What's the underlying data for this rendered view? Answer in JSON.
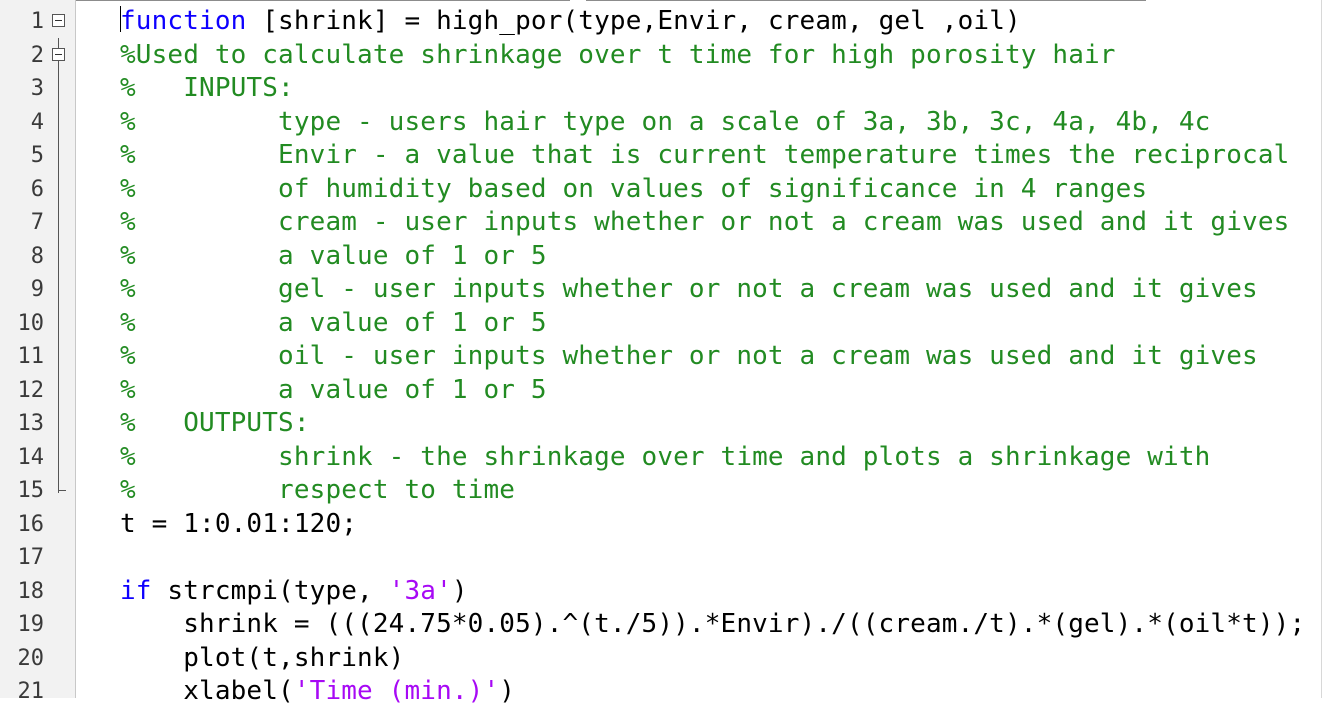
{
  "editor": {
    "lines": [
      {
        "n": "1",
        "fold": "open",
        "parts": [
          {
            "c": "kw",
            "t": "function"
          },
          {
            "c": "tx",
            "t": " [shrink] = high_por(type,Envir, cream, gel ,oil)"
          }
        ]
      },
      {
        "n": "2",
        "fold": "open",
        "parts": [
          {
            "c": "cm",
            "t": "%Used to calculate shrinkage over t time for high porosity hair"
          }
        ]
      },
      {
        "n": "3",
        "parts": [
          {
            "c": "cm",
            "t": "%   INPUTS:"
          }
        ]
      },
      {
        "n": "4",
        "parts": [
          {
            "c": "cm",
            "t": "%         type - users hair type on a scale of 3a, 3b, 3c, 4a, 4b, 4c"
          }
        ]
      },
      {
        "n": "5",
        "parts": [
          {
            "c": "cm",
            "t": "%         Envir - a value that is current temperature times the reciprocal"
          }
        ]
      },
      {
        "n": "6",
        "parts": [
          {
            "c": "cm",
            "t": "%         of humidity based on values of significance in 4 ranges"
          }
        ]
      },
      {
        "n": "7",
        "parts": [
          {
            "c": "cm",
            "t": "%         cream - user inputs whether or not a cream was used and it gives"
          }
        ]
      },
      {
        "n": "8",
        "parts": [
          {
            "c": "cm",
            "t": "%         a value of 1 or 5"
          }
        ]
      },
      {
        "n": "9",
        "parts": [
          {
            "c": "cm",
            "t": "%         gel - user inputs whether or not a cream was used and it gives"
          }
        ]
      },
      {
        "n": "10",
        "parts": [
          {
            "c": "cm",
            "t": "%         a value of 1 or 5"
          }
        ]
      },
      {
        "n": "11",
        "parts": [
          {
            "c": "cm",
            "t": "%         oil - user inputs whether or not a cream was used and it gives"
          }
        ]
      },
      {
        "n": "12",
        "parts": [
          {
            "c": "cm",
            "t": "%         a value of 1 or 5"
          }
        ]
      },
      {
        "n": "13",
        "parts": [
          {
            "c": "cm",
            "t": "%   OUTPUTS:"
          }
        ]
      },
      {
        "n": "14",
        "parts": [
          {
            "c": "cm",
            "t": "%         shrink - the shrinkage over time and plots a shrinkage with"
          }
        ]
      },
      {
        "n": "15",
        "fold": "end",
        "parts": [
          {
            "c": "cm",
            "t": "%         respect to time"
          }
        ]
      },
      {
        "n": "16",
        "parts": [
          {
            "c": "tx",
            "t": "t = 1:0.01:120;"
          }
        ]
      },
      {
        "n": "17",
        "parts": [
          {
            "c": "tx",
            "t": ""
          }
        ]
      },
      {
        "n": "18",
        "parts": [
          {
            "c": "kw",
            "t": "if"
          },
          {
            "c": "tx",
            "t": " strcmpi(type, "
          },
          {
            "c": "st",
            "t": "'3a'"
          },
          {
            "c": "tx",
            "t": ")"
          }
        ]
      },
      {
        "n": "19",
        "parts": [
          {
            "c": "tx",
            "t": "    shrink = (((24.75*0.05).^(t./5)).*Envir)./((cream./t).*(gel).*(oil*t));"
          }
        ]
      },
      {
        "n": "20",
        "parts": [
          {
            "c": "tx",
            "t": "    plot(t,shrink)"
          }
        ]
      },
      {
        "n": "21",
        "parts": [
          {
            "c": "tx",
            "t": "    xlabel("
          },
          {
            "c": "st",
            "t": "'Time (min.)'"
          },
          {
            "c": "tx",
            "t": ")"
          }
        ]
      }
    ]
  }
}
